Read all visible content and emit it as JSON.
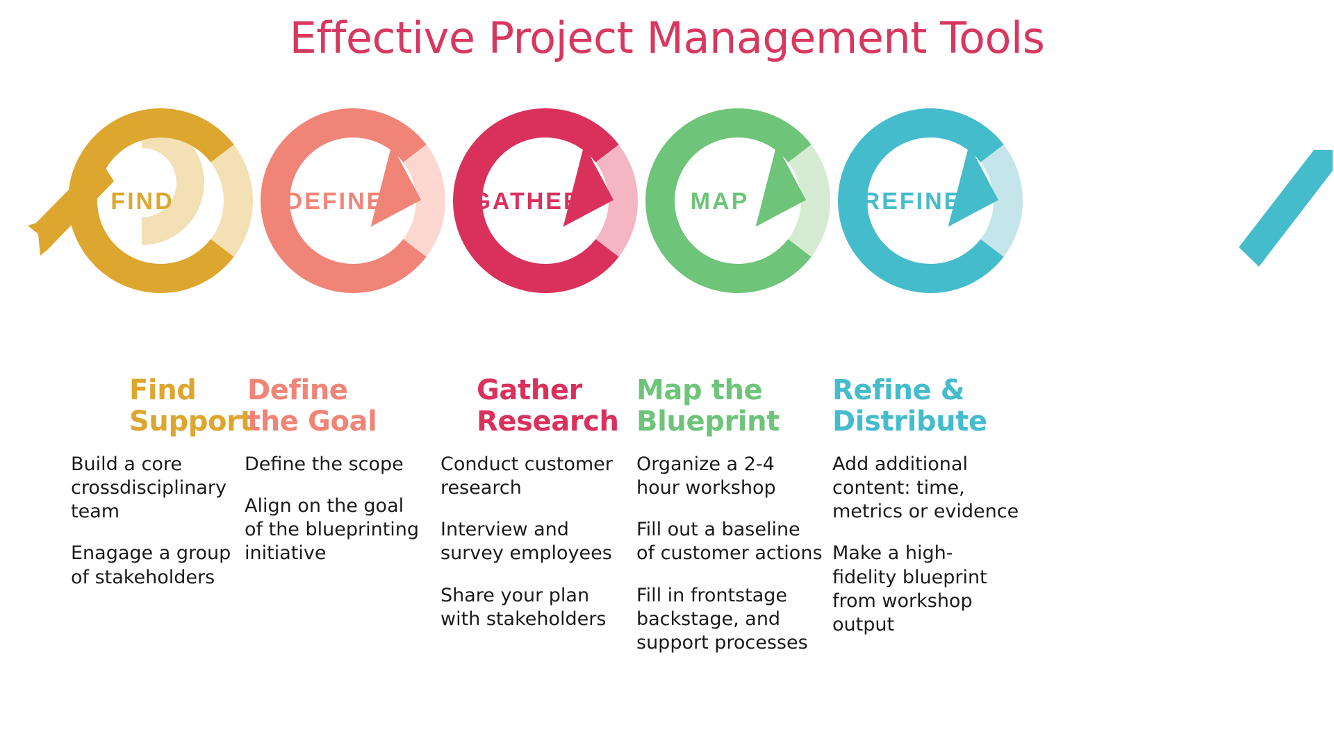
{
  "title": "Effective Project Management Tools",
  "colors": {
    "title": "#d8375f",
    "find": "#dda62f",
    "find_fade": "#f3e0b5",
    "define": "#f08477",
    "define_fade": "#fbd7cf",
    "gather": "#d9315c",
    "gather_fade": "#f3b6c2",
    "map": "#6ec478",
    "map_fade": "#d5ecd3",
    "refine": "#45bccb",
    "refine_fade": "#c4e6ea",
    "body_text": "#1a1a1a"
  },
  "steps": [
    {
      "ring_label": "FIND",
      "heading": "Find\nSupport",
      "color": "#dda62f",
      "fade": "#f3e0b5",
      "bullets": [
        "Build a core\ncrossdisciplinary\nteam",
        "Enagage a group\nof stakeholders"
      ]
    },
    {
      "ring_label": "DEFINE",
      "heading": "Define\nthe Goal",
      "color": "#f08477",
      "fade": "#fbd7cf",
      "bullets": [
        "Define the scope",
        "Align on the goal\nof the blueprinting\ninitiative"
      ]
    },
    {
      "ring_label": "GATHER",
      "heading": "Gather\nResearch",
      "color": "#d9315c",
      "fade": "#f3b6c2",
      "bullets": [
        "Conduct customer\nresearch",
        "Interview and\nsurvey employees",
        "Share your plan\nwith stakeholders"
      ]
    },
    {
      "ring_label": "MAP",
      "heading": "Map the\nBlueprint",
      "color": "#6ec478",
      "fade": "#d5ecd3",
      "bullets": [
        "Organize a 2-4\nhour workshop",
        "Fill out a baseline\nof customer actions",
        "Fill in frontstage\nbackstage, and\nsupport processes"
      ]
    },
    {
      "ring_label": "REFINE",
      "heading": "Refine &\nDistribute",
      "color": "#45bccb",
      "fade": "#c4e6ea",
      "bullets": [
        "Add additional\ncontent: time,\nmetrics or evidence",
        "Make a high-\nfidelity blueprint\nfrom workshop\noutput"
      ]
    }
  ]
}
